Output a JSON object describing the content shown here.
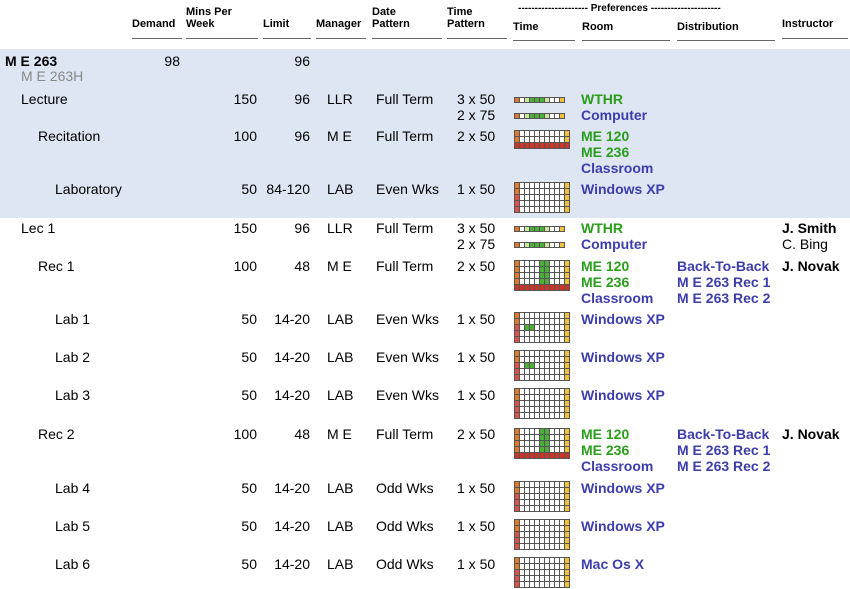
{
  "colors": {
    "band": "#dde6f2",
    "green": "#2a9d1a",
    "blue": "#3d3dab"
  },
  "header": {
    "demand": "Demand",
    "mins1": "Mins Per",
    "mins2": "Week",
    "limit": "Limit",
    "manager": "Manager",
    "date1": "Date",
    "date2": "Pattern",
    "timep1": "Time",
    "timep2": "Pattern",
    "prefs": "--------------------- Preferences ---------------------",
    "time": "Time",
    "room": "Room",
    "distribution": "Distribution",
    "instructor": "Instructor"
  },
  "course": {
    "name": "M E 263",
    "alt": "M E 263H",
    "demand": "98",
    "limit": "96"
  },
  "config_rows": [
    {
      "name": "Lecture",
      "mins": "150",
      "limit": "96",
      "manager": "LLR",
      "date": "Full Term",
      "tp1": "3 x 50",
      "tp2": "2 x 75",
      "room1": "WTHR",
      "room2": "Computer",
      "room3": ""
    },
    {
      "name": "Recitation",
      "mins": "100",
      "limit": "96",
      "manager": "M E",
      "date": "Full Term",
      "tp1": "2 x 50",
      "tp2": "",
      "room1": "ME 120",
      "room2": "ME 236",
      "room3": "Classroom"
    },
    {
      "name": "Laboratory",
      "mins": "50",
      "limit": "84-120",
      "manager": "LAB",
      "date": "Even Wks",
      "tp1": "1 x 50",
      "tp2": "",
      "room1": "Windows XP",
      "room2": "",
      "room3": ""
    }
  ],
  "class_rows": [
    {
      "name": "Lec 1",
      "mins": "150",
      "limit": "96",
      "manager": "LLR",
      "date": "Full Term",
      "tp1": "3 x 50",
      "tp2": "2 x 75",
      "room1": "WTHR",
      "room2": "Computer",
      "room3": "",
      "dist1": "",
      "dist2": "",
      "dist3": "",
      "instr1": "J. Smith",
      "instr2": "C. Bing"
    },
    {
      "name": "Rec 1",
      "mins": "100",
      "limit": "48",
      "manager": "M E",
      "date": "Full Term",
      "tp1": "2 x 50",
      "tp2": "",
      "room1": "ME 120",
      "room2": "ME 236",
      "room3": "Classroom",
      "dist1": "Back-To-Back",
      "dist2": "M E 263 Rec 1",
      "dist3": "M E 263 Rec 2",
      "instr1": "J. Novak",
      "instr2": ""
    },
    {
      "name": "Lab 1",
      "mins": "50",
      "limit": "14-20",
      "manager": "LAB",
      "date": "Even Wks",
      "tp1": "1 x 50",
      "tp2": "",
      "room1": "Windows XP",
      "room2": "",
      "room3": "",
      "dist1": "",
      "dist2": "",
      "dist3": "",
      "instr1": "",
      "instr2": ""
    },
    {
      "name": "Lab 2",
      "mins": "50",
      "limit": "14-20",
      "manager": "LAB",
      "date": "Even Wks",
      "tp1": "1 x 50",
      "tp2": "",
      "room1": "Windows XP",
      "room2": "",
      "room3": "",
      "dist1": "",
      "dist2": "",
      "dist3": "",
      "instr1": "",
      "instr2": ""
    },
    {
      "name": "Lab 3",
      "mins": "50",
      "limit": "14-20",
      "manager": "LAB",
      "date": "Even Wks",
      "tp1": "1 x 50",
      "tp2": "",
      "room1": "Windows XP",
      "room2": "",
      "room3": "",
      "dist1": "",
      "dist2": "",
      "dist3": "",
      "instr1": "",
      "instr2": ""
    },
    {
      "name": "Rec 2",
      "mins": "100",
      "limit": "48",
      "manager": "M E",
      "date": "Full Term",
      "tp1": "2 x 50",
      "tp2": "",
      "room1": "ME 120",
      "room2": "ME 236",
      "room3": "Classroom",
      "dist1": "Back-To-Back",
      "dist2": "M E 263 Rec 1",
      "dist3": "M E 263 Rec 2",
      "instr1": "J. Novak",
      "instr2": ""
    },
    {
      "name": "Lab 4",
      "mins": "50",
      "limit": "14-20",
      "manager": "LAB",
      "date": "Odd Wks",
      "tp1": "1 x 50",
      "tp2": "",
      "room1": "Windows XP",
      "room2": "",
      "room3": "",
      "dist1": "",
      "dist2": "",
      "dist3": "",
      "instr1": "",
      "instr2": ""
    },
    {
      "name": "Lab 5",
      "mins": "50",
      "limit": "14-20",
      "manager": "LAB",
      "date": "Odd Wks",
      "tp1": "1 x 50",
      "tp2": "",
      "room1": "Windows XP",
      "room2": "",
      "room3": "",
      "dist1": "",
      "dist2": "",
      "dist3": "",
      "instr1": "",
      "instr2": ""
    },
    {
      "name": "Lab 6",
      "mins": "50",
      "limit": "14-20",
      "manager": "LAB",
      "date": "Odd Wks",
      "tp1": "1 x 50",
      "tp2": "",
      "room1": "Mac Os X",
      "room2": "",
      "room3": "",
      "dist1": "",
      "dist2": "",
      "dist3": "",
      "instr1": "",
      "instr2": ""
    }
  ]
}
